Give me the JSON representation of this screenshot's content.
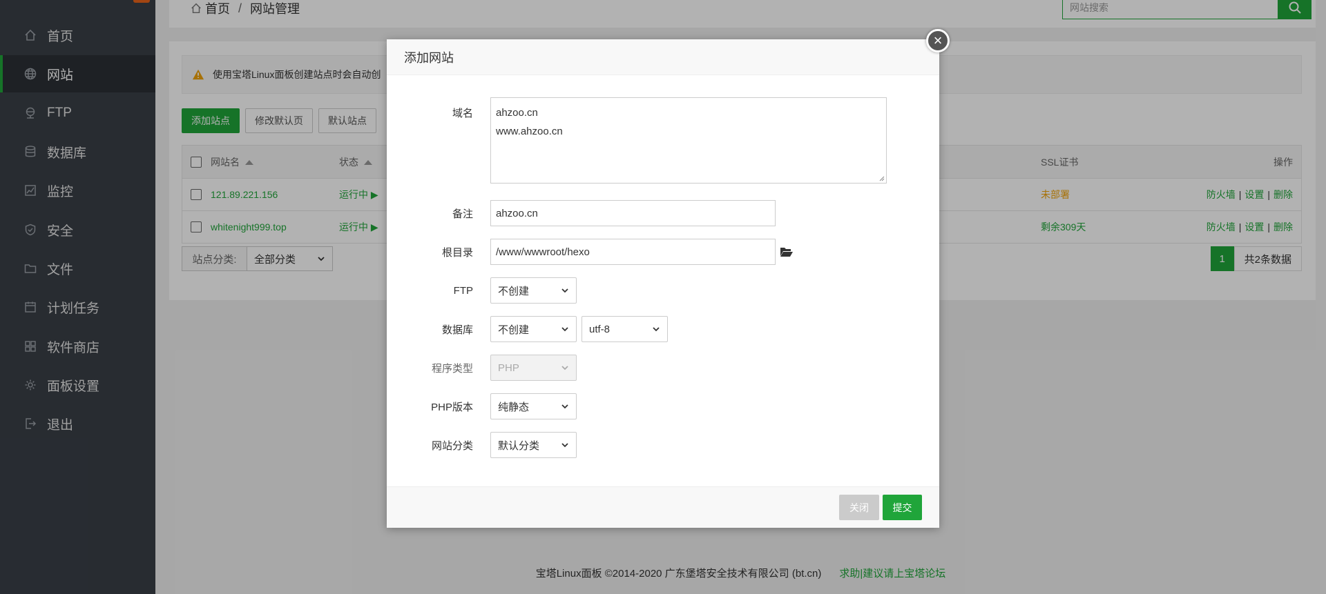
{
  "sidebar": {
    "items": [
      {
        "label": "首页",
        "icon": "home-icon"
      },
      {
        "label": "网站",
        "icon": "globe-icon",
        "active": true
      },
      {
        "label": "FTP",
        "icon": "ftp-icon"
      },
      {
        "label": "数据库",
        "icon": "database-icon"
      },
      {
        "label": "监控",
        "icon": "monitor-icon"
      },
      {
        "label": "安全",
        "icon": "shield-icon"
      },
      {
        "label": "文件",
        "icon": "folder-icon"
      },
      {
        "label": "计划任务",
        "icon": "calendar-icon"
      },
      {
        "label": "软件商店",
        "icon": "grid-icon"
      },
      {
        "label": "面板设置",
        "icon": "gear-icon"
      },
      {
        "label": "退出",
        "icon": "logout-icon"
      }
    ]
  },
  "breadcrumb": {
    "home": "首页",
    "current": "网站管理"
  },
  "search": {
    "placeholder": "网站搜索"
  },
  "notice": {
    "text": "使用宝塔Linux面板创建站点时会自动创"
  },
  "toolbar": {
    "add_site": "添加站点",
    "edit_default": "修改默认页",
    "default_site": "默认站点"
  },
  "table": {
    "headers": {
      "name": "网站名",
      "status": "状态",
      "ssl": "SSL证书",
      "ops": "操作"
    },
    "rows": [
      {
        "name": "121.89.221.156",
        "status": "运行中 ▶",
        "ssl": "未部署",
        "ssl_color": "#f0a30a"
      },
      {
        "name": "whitenight999.top",
        "status": "运行中 ▶",
        "ssl": "剩余309天",
        "ssl_color": "#20a53a"
      }
    ],
    "ops": {
      "firewall": "防火墙",
      "settings": "设置",
      "delete": "删除",
      "sep": "|"
    }
  },
  "category": {
    "label": "站点分类:",
    "value": "全部分类"
  },
  "pager": {
    "current": "1",
    "total": "共2条数据"
  },
  "footer": {
    "copyright": "宝塔Linux面板 ©2014-2020 广东堡塔安全技术有限公司 (bt.cn)",
    "link": "求助|建议请上宝塔论坛"
  },
  "modal": {
    "title": "添加网站",
    "close_icon": "×",
    "fields": {
      "domain": {
        "label": "域名",
        "line1": "ahzoo.cn",
        "line2": "www.ahzoo.cn"
      },
      "remark": {
        "label": "备注",
        "value": "ahzoo.cn"
      },
      "root": {
        "label": "根目录",
        "value": "/www/wwwroot/hexo"
      },
      "ftp": {
        "label": "FTP",
        "value": "不创建"
      },
      "db": {
        "label": "数据库",
        "value": "不创建",
        "charset": "utf-8"
      },
      "program": {
        "label": "程序类型",
        "value": "PHP"
      },
      "php": {
        "label": "PHP版本",
        "value": "纯静态"
      },
      "category": {
        "label": "网站分类",
        "value": "默认分类"
      }
    },
    "buttons": {
      "close": "关闭",
      "submit": "提交"
    }
  },
  "colors": {
    "brand": "#20a53a",
    "sidebar": "#3a3f47",
    "warning": "#f0a30a"
  }
}
